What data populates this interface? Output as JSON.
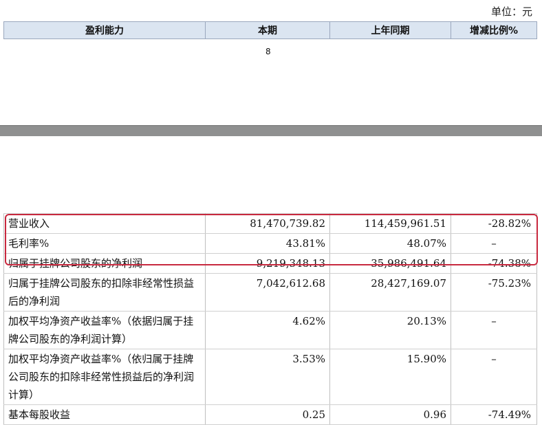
{
  "unit_label": "单位：元",
  "header": {
    "col1": "盈利能力",
    "col2": "本期",
    "col3": "上年同期",
    "col4": "增减比例%"
  },
  "page_number": "8",
  "rows": [
    {
      "label": "营业收入",
      "current": "81,470,739.82",
      "prior": "114,459,961.51",
      "change": "-28.82%"
    },
    {
      "label": "毛利率%",
      "current": "43.81%",
      "prior": "48.07%",
      "change": "–"
    },
    {
      "label": "归属于挂牌公司股东的净利润",
      "current": "9,219,348.13",
      "prior": "35,986,491.64",
      "change": "-74.38%"
    },
    {
      "label": "归属于挂牌公司股东的扣除非经常性损益后的净利润",
      "current": "7,042,612.68",
      "prior": "28,427,169.07",
      "change": "-75.23%"
    },
    {
      "label": "加权平均净资产收益率%（依据归属于挂牌公司股东的净利润计算）",
      "current": "4.62%",
      "prior": "20.13%",
      "change": "–"
    },
    {
      "label": "加权平均净资产收益率%（依归属于挂牌公司股东的扣除非经常性损益后的净利润计算）",
      "current": "3.53%",
      "prior": "15.90%",
      "change": "–"
    },
    {
      "label": "基本每股收益",
      "current": "0.25",
      "prior": "0.96",
      "change": "-74.49%"
    }
  ],
  "highlight_color": "#c8283e",
  "header_bg": "#dbe5f1"
}
